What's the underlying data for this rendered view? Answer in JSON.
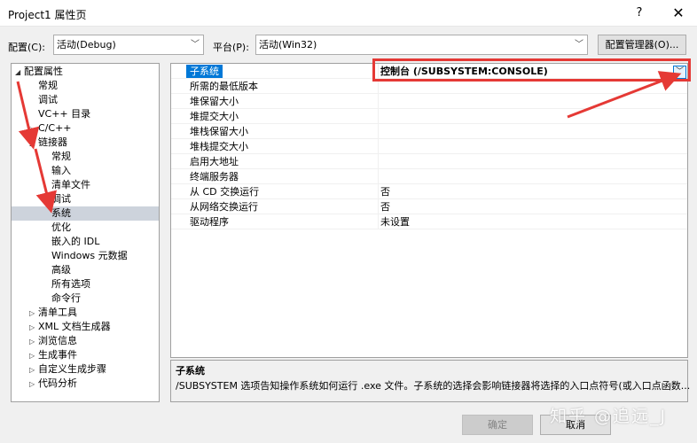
{
  "window": {
    "title": "Project1 属性页",
    "help": "?",
    "close": "✕"
  },
  "toolbar": {
    "config_label": "配置(C):",
    "config_value": "活动(Debug)",
    "platform_label": "平台(P):",
    "platform_value": "活动(Win32)",
    "config_manager": "配置管理器(O)..."
  },
  "tree": [
    {
      "label": "配置属性",
      "toggle": "◢"
    },
    {
      "label": "常规"
    },
    {
      "label": "调试"
    },
    {
      "label": "VC++ 目录"
    },
    {
      "label": "C/C++",
      "toggle": "▷"
    },
    {
      "label": "链接器",
      "toggle": "◢"
    },
    {
      "label": "常规"
    },
    {
      "label": "输入"
    },
    {
      "label": "清单文件"
    },
    {
      "label": "调试"
    },
    {
      "label": "系统"
    },
    {
      "label": "优化"
    },
    {
      "label": "嵌入的 IDL"
    },
    {
      "label": "Windows 元数据"
    },
    {
      "label": "高级"
    },
    {
      "label": "所有选项"
    },
    {
      "label": "命令行"
    },
    {
      "label": "清单工具",
      "toggle": "▷"
    },
    {
      "label": "XML 文档生成器",
      "toggle": "▷"
    },
    {
      "label": "浏览信息",
      "toggle": "▷"
    },
    {
      "label": "生成事件",
      "toggle": "▷"
    },
    {
      "label": "自定义生成步骤",
      "toggle": "▷"
    },
    {
      "label": "代码分析",
      "toggle": "▷"
    }
  ],
  "properties": [
    {
      "name": "子系统",
      "value": "控制台 (/SUBSYSTEM:CONSOLE)"
    },
    {
      "name": "所需的最低版本",
      "value": ""
    },
    {
      "name": "堆保留大小",
      "value": ""
    },
    {
      "name": "堆提交大小",
      "value": ""
    },
    {
      "name": "堆栈保留大小",
      "value": ""
    },
    {
      "name": "堆栈提交大小",
      "value": ""
    },
    {
      "name": "启用大地址",
      "value": ""
    },
    {
      "name": "终端服务器",
      "value": ""
    },
    {
      "name": "从 CD 交换运行",
      "value": "否"
    },
    {
      "name": "从网络交换运行",
      "value": "否"
    },
    {
      "name": "驱动程序",
      "value": "未设置"
    }
  ],
  "description": {
    "title": "子系统",
    "text": "/SUBSYSTEM 选项告知操作系统如何运行 .exe 文件。子系统的选择会影响链接器将选择的入口点符号(或入口点函数..."
  },
  "footer": {
    "ok": "确定",
    "cancel": "取消"
  },
  "watermark": "知乎 @追远_J",
  "colors": {
    "highlight": "#0078d7",
    "annotation": "#e53935",
    "selected_tree": "#cdd3dc"
  },
  "icons": {
    "dropdown": "chevron-down-icon",
    "expanded": "triangle-expanded-icon",
    "collapsed": "triangle-collapsed-icon"
  }
}
